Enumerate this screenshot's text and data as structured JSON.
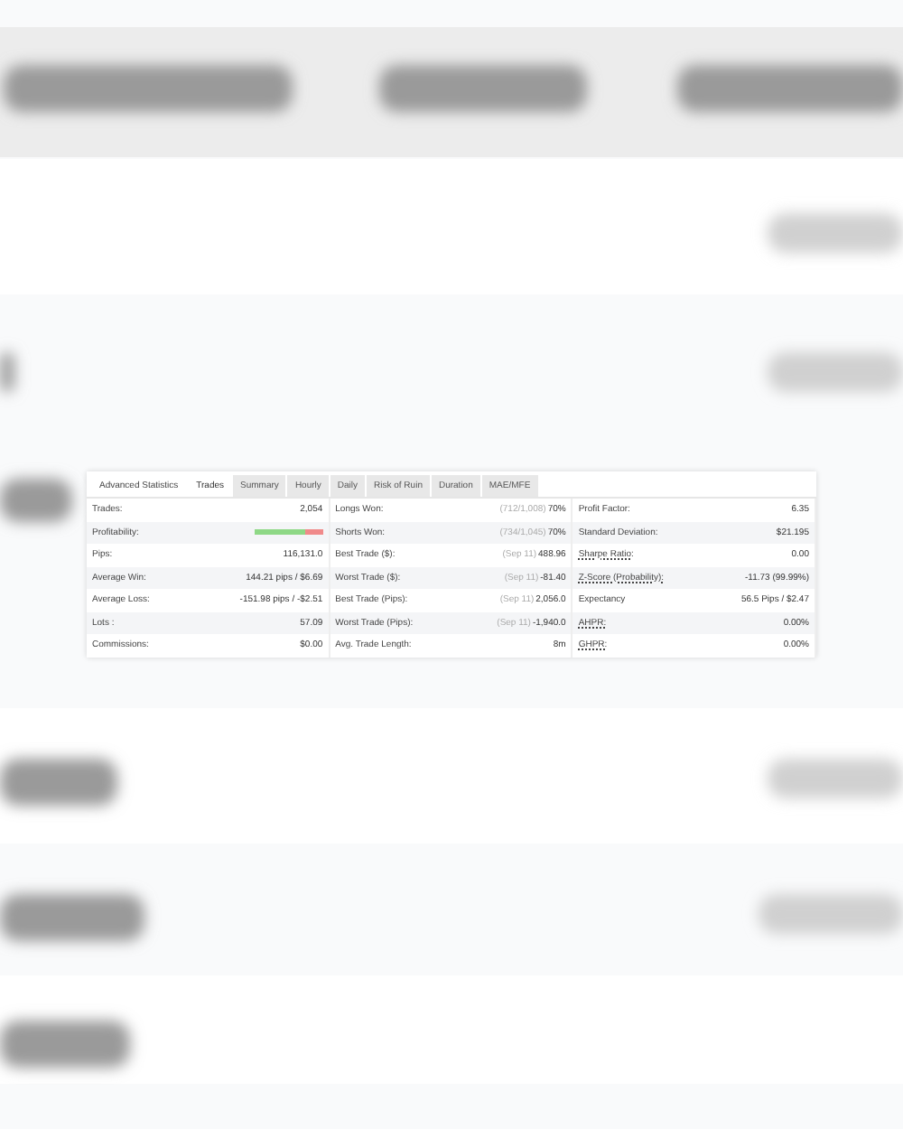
{
  "panel": {
    "title": "Advanced Statistics",
    "tabs": [
      {
        "label": "Trades",
        "selected": true
      },
      {
        "label": "Summary",
        "selected": false
      },
      {
        "label": "Hourly",
        "selected": false
      },
      {
        "label": "Daily",
        "selected": false
      },
      {
        "label": "Risk of Ruin",
        "selected": false
      },
      {
        "label": "Duration",
        "selected": false
      },
      {
        "label": "MAE/MFE",
        "selected": false
      }
    ],
    "columns": [
      [
        {
          "label": "Trades:",
          "kind": "text",
          "value": "2,054"
        },
        {
          "label": "Profitability:",
          "kind": "bar",
          "level": 0.74
        },
        {
          "label": "Pips:",
          "kind": "text",
          "value": "116,131.0"
        },
        {
          "label": "Average Win:",
          "kind": "text",
          "value": "144.21 pips / $6.69"
        },
        {
          "label": "Average Loss:",
          "kind": "text",
          "value": "-151.98 pips / -$2.51"
        },
        {
          "label": "Lots :",
          "kind": "text",
          "value": "57.09"
        },
        {
          "label": "Commissions:",
          "kind": "text",
          "value": "$0.00"
        }
      ],
      [
        {
          "label": "Longs Won:",
          "kind": "text",
          "note": "(712/1,008)",
          "value": "70%"
        },
        {
          "label": "Shorts Won:",
          "kind": "text",
          "note": "(734/1,045)",
          "value": "70%"
        },
        {
          "label": "Best Trade ($):",
          "kind": "text",
          "note": "(Sep 11)",
          "value": "488.96"
        },
        {
          "label": "Worst Trade ($):",
          "kind": "text",
          "note": "(Sep 11)",
          "value": "-81.40"
        },
        {
          "label": "Best Trade (Pips):",
          "kind": "text",
          "note": "(Sep 11)",
          "value": "2,056.0"
        },
        {
          "label": "Worst Trade (Pips):",
          "kind": "text",
          "note": "(Sep 11)",
          "value": "-1,940.0"
        },
        {
          "label": "Avg. Trade Length:",
          "kind": "text",
          "value": "8m"
        }
      ],
      [
        {
          "label": "Profit Factor:",
          "kind": "text",
          "value": "6.35"
        },
        {
          "label": "Standard Deviation:",
          "kind": "text",
          "value": "$21.195"
        },
        {
          "label": "Sharpe Ratio:",
          "kind": "text",
          "value": "0.00",
          "underlined": true
        },
        {
          "label": "Z-Score (Probability):",
          "kind": "text",
          "value": "-11.73 (99.99%)",
          "underlined": true
        },
        {
          "label": "Expectancy",
          "kind": "text",
          "value": "56.5 Pips / $2.47"
        },
        {
          "label": "AHPR:",
          "kind": "text",
          "value": "0.00%",
          "underlined": true
        },
        {
          "label": "GHPR:",
          "kind": "text",
          "value": "0.00%",
          "underlined": true
        }
      ]
    ]
  }
}
